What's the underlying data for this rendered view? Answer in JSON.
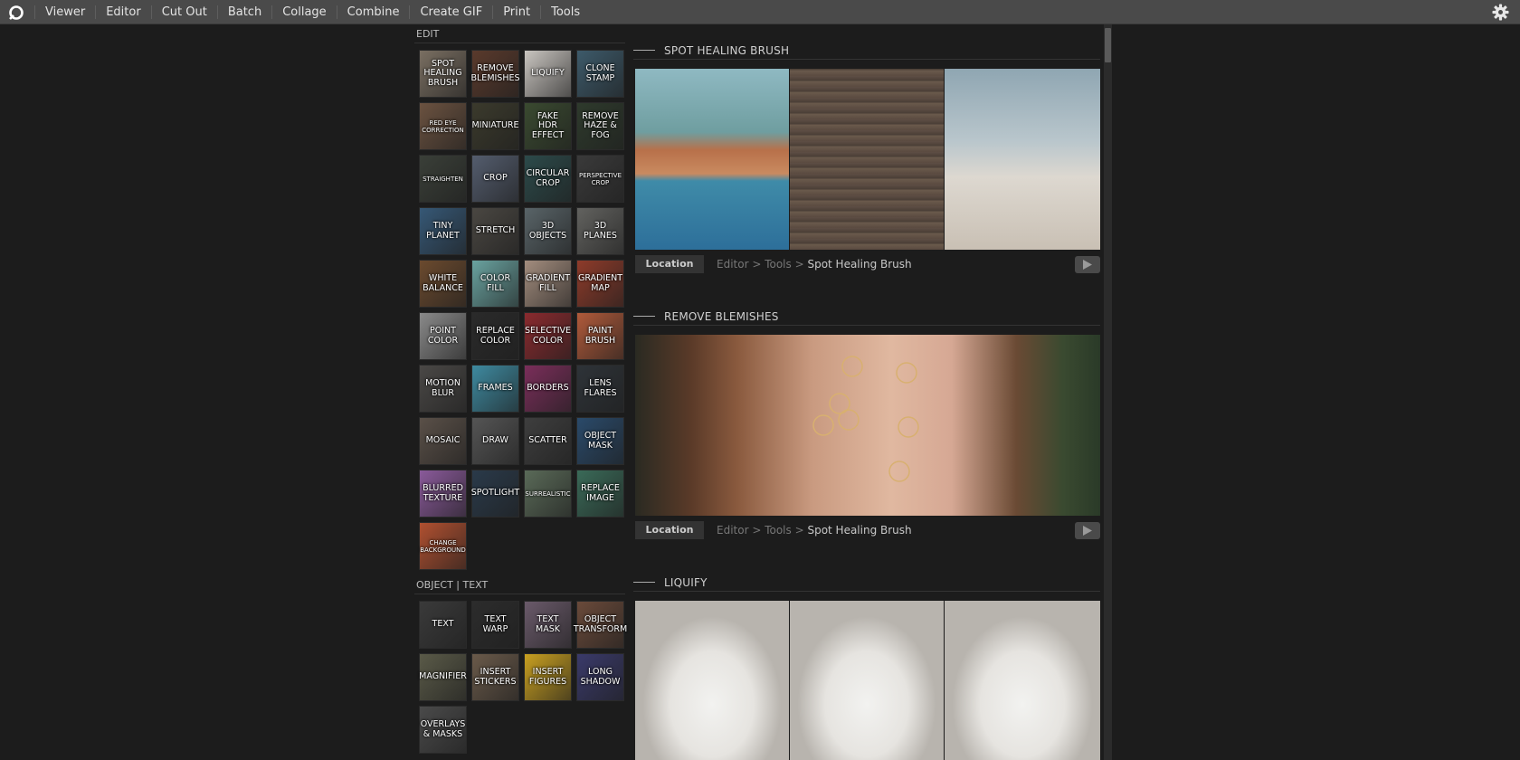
{
  "nav": [
    "Viewer",
    "Editor",
    "Cut Out",
    "Batch",
    "Collage",
    "Combine",
    "Create GIF",
    "Print",
    "Tools"
  ],
  "icons": {
    "logo": "app-logo-icon",
    "settings": "gear-icon",
    "play": "play-icon"
  },
  "edit": {
    "label": "EDIT",
    "tiles": [
      {
        "label": "SPOT HEALING BRUSH",
        "bg": "#7a6f62",
        "small": false
      },
      {
        "label": "REMOVE BLEMISHES",
        "bg": "#5a3a2c",
        "small": false
      },
      {
        "label": "LIQUIFY",
        "bg": "#c9c5c0",
        "small": false
      },
      {
        "label": "CLONE STAMP",
        "bg": "#3d5a6a",
        "small": false
      },
      {
        "label": "RED EYE CORRECTION",
        "bg": "#6b5240",
        "small": true
      },
      {
        "label": "MINIATURE",
        "bg": "#3b3a2c",
        "small": false
      },
      {
        "label": "FAKE HDR EFFECT",
        "bg": "#3a4a30",
        "small": false
      },
      {
        "label": "REMOVE HAZE & FOG",
        "bg": "#2e3a2c",
        "small": false
      },
      {
        "label": "STRAIGHTEN",
        "bg": "#3a3f38",
        "small": true
      },
      {
        "label": "CROP",
        "bg": "#545d6e",
        "small": false
      },
      {
        "label": "CIRCULAR CROP",
        "bg": "#2c4a4a",
        "small": false
      },
      {
        "label": "PERSPECTIVE CROP",
        "bg": "#3a3a3a",
        "small": true
      },
      {
        "label": "TINY PLANET",
        "bg": "#365876",
        "small": false
      },
      {
        "label": "STRETCH",
        "bg": "#4a4742",
        "small": false
      },
      {
        "label": "3D OBJECTS",
        "bg": "#596468",
        "small": false
      },
      {
        "label": "3D PLANES",
        "bg": "#62625f",
        "small": false
      },
      {
        "label": "WHITE BALANCE",
        "bg": "#6b4a2e",
        "small": false
      },
      {
        "label": "COLOR FILL",
        "bg": "#6aa3a0",
        "small": false
      },
      {
        "label": "GRADIENT FILL",
        "bg": "#a38d7e",
        "small": false
      },
      {
        "label": "GRADIENT MAP",
        "bg": "#8e3b2a",
        "small": false
      },
      {
        "label": "POINT COLOR",
        "bg": "#8a8a8a",
        "small": false
      },
      {
        "label": "REPLACE COLOR",
        "bg": "#2a2a2a",
        "small": false
      },
      {
        "label": "SELECTIVE COLOR",
        "bg": "#8a2a2e",
        "small": false
      },
      {
        "label": "PAINT BRUSH",
        "bg": "#b05a3a",
        "small": false
      },
      {
        "label": "MOTION BLUR",
        "bg": "#4a4846",
        "small": false
      },
      {
        "label": "FRAMES",
        "bg": "#3e8aa0",
        "small": false
      },
      {
        "label": "BORDERS",
        "bg": "#7a2e5a",
        "small": false
      },
      {
        "label": "LENS FLARES",
        "bg": "#2e3338",
        "small": false
      },
      {
        "label": "MOSAIC",
        "bg": "#5a5048",
        "small": false
      },
      {
        "label": "DRAW",
        "bg": "#555555",
        "small": false
      },
      {
        "label": "SCATTER",
        "bg": "#3e3e3e",
        "small": false
      },
      {
        "label": "OBJECT MASK",
        "bg": "#2a4a6a",
        "small": false
      },
      {
        "label": "BLURRED TEXTURE",
        "bg": "#8a5a9a",
        "small": false
      },
      {
        "label": "SPOTLIGHT",
        "bg": "#2a3a4a",
        "small": false
      },
      {
        "label": "SURREALISTIC",
        "bg": "#5a6a58",
        "small": true
      },
      {
        "label": "REPLACE IMAGE",
        "bg": "#3a6a58",
        "small": false
      },
      {
        "label": "CHANGE BACKGROUND",
        "bg": "#b05030",
        "small": true
      }
    ]
  },
  "object_text": {
    "label": "OBJECT | TEXT",
    "tiles": [
      {
        "label": "TEXT",
        "bg": "#3a3a3a",
        "small": false
      },
      {
        "label": "TEXT WARP",
        "bg": "#2c2c2c",
        "small": false
      },
      {
        "label": "TEXT MASK",
        "bg": "#6a5a6a",
        "small": false
      },
      {
        "label": "OBJECT TRANSFORM",
        "bg": "#6a4a3a",
        "small": false
      },
      {
        "label": "MAGNIFIER",
        "bg": "#5a5a48",
        "small": false
      },
      {
        "label": "INSERT STICKERS",
        "bg": "#6a5a4a",
        "small": false
      },
      {
        "label": "INSERT FIGURES",
        "bg": "#c9a020",
        "small": false
      },
      {
        "label": "LONG SHADOW",
        "bg": "#3a3a6a",
        "small": false
      },
      {
        "label": "OVERLAYS & MASKS",
        "bg": "#4a4a4a",
        "small": false
      }
    ]
  },
  "sections": [
    {
      "title": "SPOT HEALING BRUSH",
      "location_label": "Location",
      "path": [
        "Editor",
        "Tools",
        "Spot Healing Brush"
      ]
    },
    {
      "title": "REMOVE BLEMISHES",
      "location_label": "Location",
      "path": [
        "Editor",
        "Tools",
        "Spot Healing Brush"
      ]
    },
    {
      "title": "LIQUIFY"
    }
  ]
}
